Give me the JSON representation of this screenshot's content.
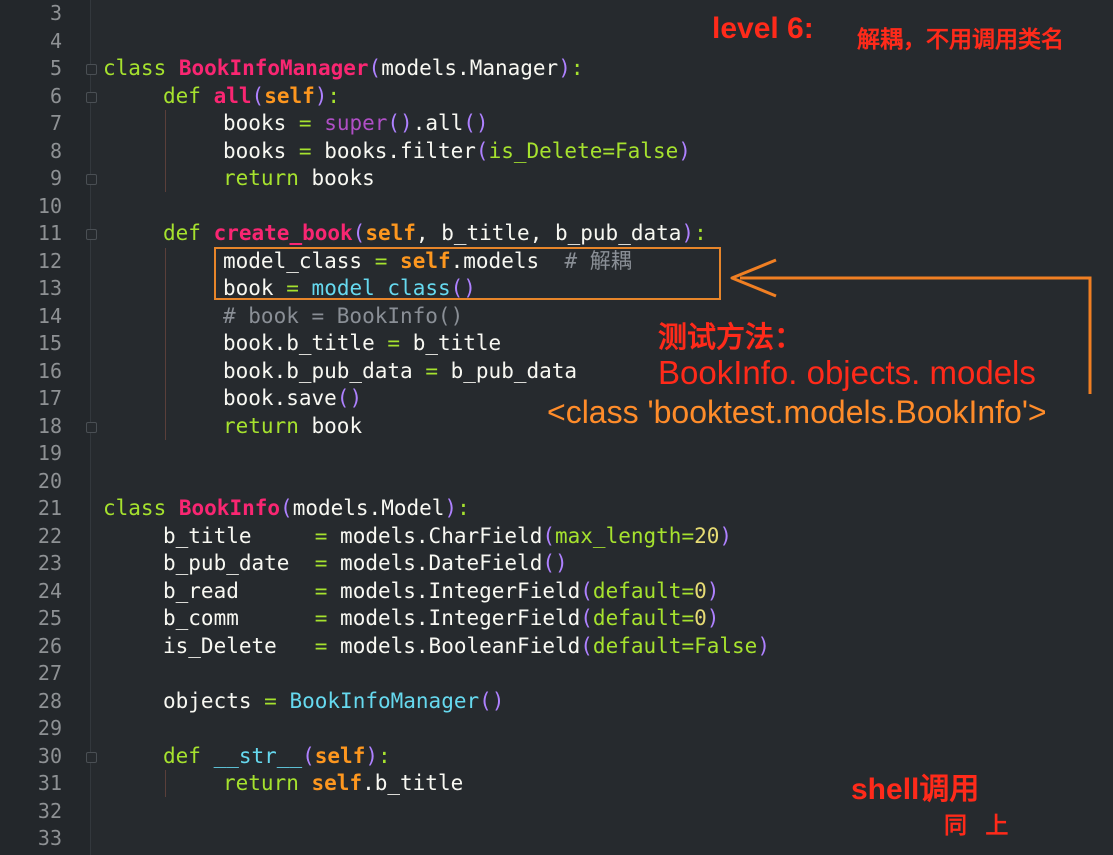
{
  "gutter": {
    "line_numbers": [
      "3",
      "4",
      "5",
      "6",
      "7",
      "8",
      "9",
      "10",
      "11",
      "12",
      "13",
      "14",
      "15",
      "16",
      "17",
      "18",
      "19",
      "20",
      "21",
      "22",
      "23",
      "24",
      "25",
      "26",
      "27",
      "28",
      "29",
      "30",
      "31",
      "32",
      "33"
    ]
  },
  "code": {
    "l5": {
      "kw": "class",
      "name": "BookInfoManager",
      "p1": "(",
      "base": "models.Manager",
      "p2": ")",
      "colon": ":"
    },
    "l6": {
      "kw": "def",
      "name": "all",
      "p1": "(",
      "self": "self",
      "p2": ")",
      "colon": ":"
    },
    "l7": {
      "lhs": "books",
      "eq": "=",
      "builtin": "super",
      "p1": "()",
      "dot": ".all",
      "p2": "()"
    },
    "l8": {
      "lhs": "books",
      "eq": "=",
      "call": "books.filter",
      "p1": "(",
      "kwarg": "is_Delete",
      "kweq": "=",
      "val": "False",
      "p2": ")"
    },
    "l9": {
      "kw": "return",
      "val": "books"
    },
    "l11": {
      "kw": "def",
      "name": "create_book",
      "p1": "(",
      "self": "self",
      "rest": ", b_title, b_pub_data",
      "p2": ")",
      "colon": ":"
    },
    "l12": {
      "lhs": "model_class",
      "eq": "=",
      "self": "self",
      "attr": ".models",
      "comment": "# 解耦"
    },
    "l13": {
      "lhs": "book",
      "eq": "=",
      "inst": "model_class",
      "p": "()"
    },
    "l14": {
      "comment": "# book = BookInfo()"
    },
    "l15": {
      "lhs": "book.b_title",
      "eq": "=",
      "rhs": "b_title"
    },
    "l16": {
      "lhs": "book.b_pub_data",
      "eq": "=",
      "rhs": "b_pub_data"
    },
    "l17": {
      "call": "book.save",
      "p": "()"
    },
    "l18": {
      "kw": "return",
      "val": "book"
    },
    "l21": {
      "kw": "class",
      "name": "BookInfo",
      "p1": "(",
      "base": "models.Model",
      "p2": ")",
      "colon": ":"
    },
    "l22": {
      "field": "b_title    ",
      "eq": "=",
      "call": "models.CharField",
      "p1": "(",
      "kwarg": "max_length",
      "kweq": "=",
      "val": "20",
      "p2": ")"
    },
    "l23": {
      "field": "b_pub_date ",
      "eq": "=",
      "call": "models.DateField",
      "p": "()"
    },
    "l24": {
      "field": "b_read     ",
      "eq": "=",
      "call": "models.IntegerField",
      "p1": "(",
      "kwarg": "default",
      "kweq": "=",
      "val": "0",
      "p2": ")"
    },
    "l25": {
      "field": "b_comm     ",
      "eq": "=",
      "call": "models.IntegerField",
      "p1": "(",
      "kwarg": "default",
      "kweq": "=",
      "val": "0",
      "p2": ")"
    },
    "l26": {
      "field": "is_Delete  ",
      "eq": "=",
      "call": "models.BooleanField",
      "p1": "(",
      "kwarg": "default",
      "kweq": "=",
      "val": "False",
      "p2": ")"
    },
    "l28": {
      "lhs": "objects",
      "eq": "=",
      "inst": "BookInfoManager",
      "p": "()"
    },
    "l30": {
      "kw": "def",
      "name": "__str__",
      "p1": "(",
      "self": "self",
      "p2": ")",
      "colon": ":"
    },
    "l31": {
      "kw": "return",
      "self": "self",
      "attr": ".b_title"
    }
  },
  "annotations": {
    "level": "level 6:",
    "level_note": "解耦，不用调用类名",
    "test_method": "测试方法：",
    "test_expr": "BookInfo. objects. models",
    "test_result": "<class 'booktest.models.BookInfo'>",
    "shell": "shell调用",
    "same": "同 上"
  },
  "colors": {
    "background": "#262a2e",
    "keyword": "#a6e22e",
    "class_name": "#f92672",
    "self": "#fd971f",
    "annotation_red": "#ff2a1a",
    "annotation_orange": "#ff8c2a",
    "highlight_box": "#e7852a"
  }
}
